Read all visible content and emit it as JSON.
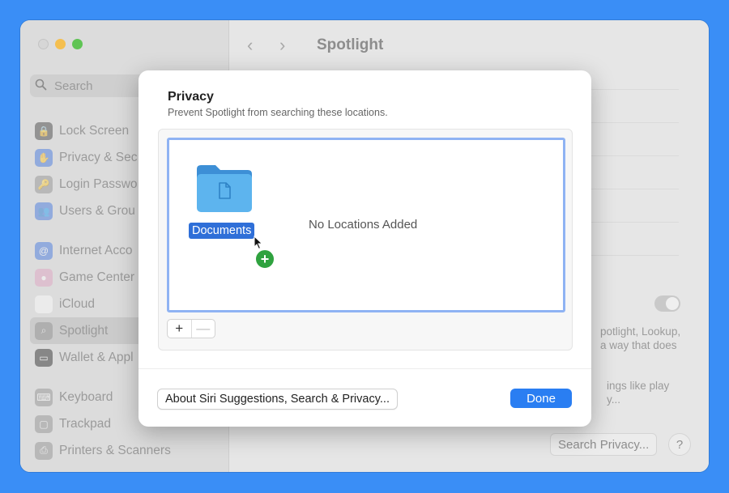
{
  "window": {
    "sidebar": {
      "search_placeholder": "Search",
      "items": [
        {
          "label": "Lock Screen",
          "icon": "lock-icon",
          "color": "#3d3d3d"
        },
        {
          "label": "Privacy & Sec",
          "icon": "hand-icon",
          "color": "#3a72e0"
        },
        {
          "label": "Login Passwo",
          "icon": "key-icon",
          "color": "#8e8e8e"
        },
        {
          "label": "Users & Grou",
          "icon": "users-icon",
          "color": "#3a72e0"
        },
        {
          "label": "Internet Acco",
          "icon": "at-icon",
          "color": "#3a72e0"
        },
        {
          "label": "Game Center",
          "icon": "game-center-icon",
          "color": "#e0a0c0"
        },
        {
          "label": "iCloud",
          "icon": "cloud-icon",
          "color": "#ffffff"
        },
        {
          "label": "Spotlight",
          "icon": "magnifier-icon",
          "color": "#8e8e8e"
        },
        {
          "label": "Wallet & Appl",
          "icon": "wallet-icon",
          "color": "#222222"
        },
        {
          "label": "Keyboard",
          "icon": "keyboard-icon",
          "color": "#8e8e8e"
        },
        {
          "label": "Trackpad",
          "icon": "trackpad-icon",
          "color": "#8e8e8e"
        },
        {
          "label": "Printers & Scanners",
          "icon": "printer-icon",
          "color": "#8e8e8e"
        }
      ]
    },
    "toolbar": {
      "title": "Spotlight",
      "back": "‹",
      "forward": "›"
    },
    "background": {
      "text1_line1": "potlight, Lookup,",
      "text1_line2": "a way that does",
      "text2_line1": "ings like play",
      "text2_line2": "y...",
      "search_privacy_button": "Search Privacy...",
      "help_button": "?"
    }
  },
  "modal": {
    "title": "Privacy",
    "subtitle": "Prevent Spotlight from searching these locations.",
    "dragged_item": "Documents",
    "empty_state": "No Locations Added",
    "add_button": "+",
    "remove_button": "—",
    "about_button": "About Siri Suggestions, Search & Privacy...",
    "done_button": "Done"
  },
  "colors": {
    "accent": "#2a7ef2",
    "drop_border": "#8fb3f3",
    "add_badge": "#2fa23f",
    "background": "#3a8ef6"
  }
}
